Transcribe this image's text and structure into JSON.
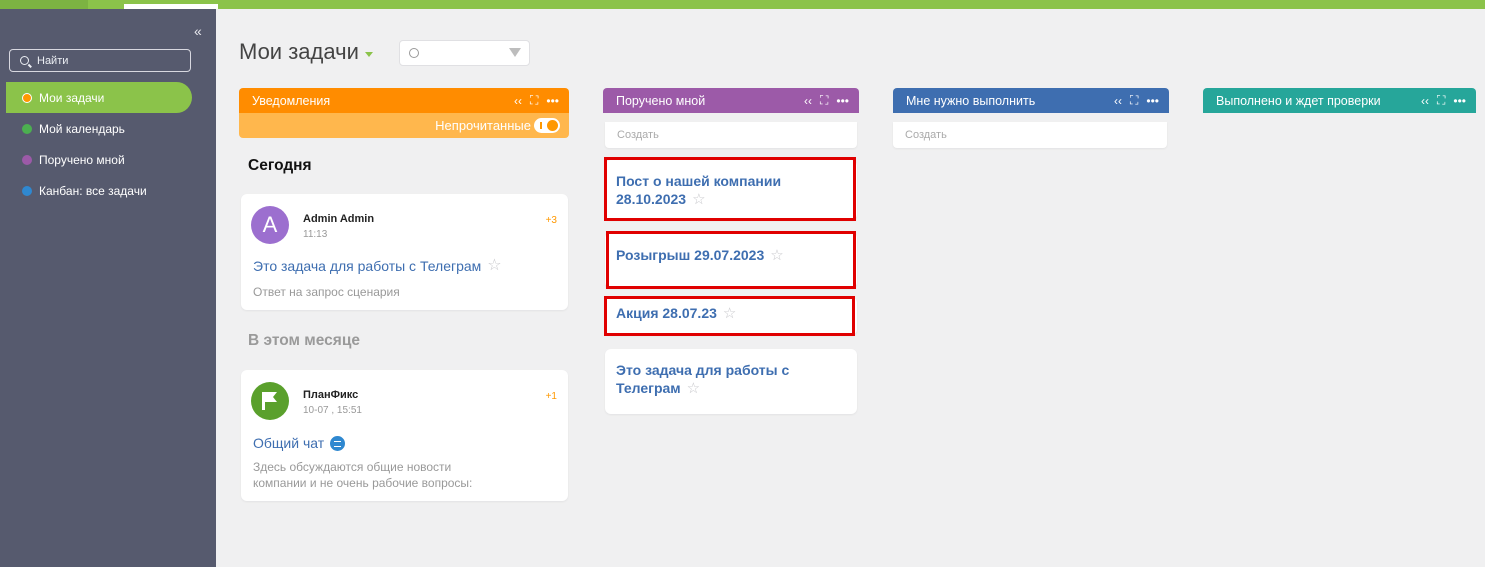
{
  "sidebar": {
    "search_label": "Найти",
    "items": [
      {
        "label": "Мои задачи",
        "color": "#ff9800",
        "active": true
      },
      {
        "label": "Мой календарь",
        "color": "#4caf50",
        "active": false
      },
      {
        "label": "Поручено мной",
        "color": "#9c5aa8",
        "active": false
      },
      {
        "label": "Канбан: все задачи",
        "color": "#2f88d0",
        "active": false
      }
    ]
  },
  "main": {
    "title": "Мои задачи"
  },
  "columns": {
    "notifications": {
      "title": "Уведомления",
      "color": "#ff8c00",
      "toggle_label": "Непрочитанные",
      "sections": [
        {
          "heading": "Сегодня",
          "card": {
            "avatar_letter": "A",
            "avatar_color": "#9c6fcf",
            "author": "Admin Admin",
            "time": "11:13",
            "count": "+3",
            "task": "Это задача для работы с Телеграм",
            "description": "Ответ на запрос сценария"
          }
        },
        {
          "heading": "В этом месяце",
          "card": {
            "avatar_color": "#5aa02c",
            "author": "ПланФикс",
            "time": "10-07 , 15:51",
            "count": "+1",
            "task": "Общий чат",
            "description": "Здесь обсуждаются общие новости компании и не очень рабочие вопросы:"
          }
        }
      ]
    },
    "assigned_by_me": {
      "title": "Поручено мной",
      "color": "#9c5aa8",
      "create_placeholder": "Создать",
      "tasks": [
        {
          "title": "Пост о нашей компании 28.10.2023"
        },
        {
          "title": "Розыгрыш 29.07.2023"
        },
        {
          "title": "Акция 28.07.23"
        },
        {
          "title": "Это задача для работы с Телеграм"
        }
      ]
    },
    "need_to_do": {
      "title": "Мне нужно выполнить",
      "color": "#3e6eb0",
      "create_placeholder": "Создать"
    },
    "done_waiting": {
      "title": "Выполнено и ждет проверки",
      "color": "#26a69a"
    }
  },
  "icons": {
    "collapse": "chevron-double-left-icon",
    "focus": "focus-frame-icon",
    "more": "more-dots-icon",
    "star": "star-outline-icon",
    "filter": "filter-icon"
  }
}
